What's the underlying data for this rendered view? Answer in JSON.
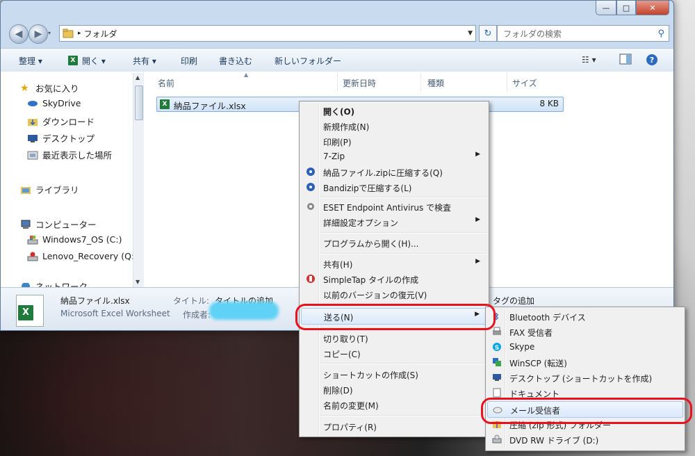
{
  "window": {
    "controls": {
      "minimize": "—",
      "maximize": "□",
      "close": "✕"
    }
  },
  "address": {
    "path": "フォルダ",
    "search_placeholder": "フォルダの検索"
  },
  "toolbar": {
    "organize": "整理 ▾",
    "open": "開く ▾",
    "share": "共有 ▾",
    "print": "印刷",
    "burn": "書き込む",
    "new_folder": "新しいフォルダー"
  },
  "nav": {
    "favorites": "お気に入り",
    "skydrive": "SkyDrive",
    "downloads": "ダウンロード",
    "desktop": "デスクトップ",
    "recent": "最近表示した場所",
    "libraries": "ライブラリ",
    "computer": "コンピューター",
    "drive_c": "Windows7_OS (C:)",
    "drive_q": "Lenovo_Recovery (Q:",
    "network": "ネットワーク"
  },
  "columns": {
    "name": "名前",
    "modified": "更新日時",
    "type": "種類",
    "size": "サイズ"
  },
  "file": {
    "name": "納品ファイル.xlsx",
    "size": "8 KB"
  },
  "details": {
    "name": "納品ファイル.xlsx",
    "type": "Microsoft Excel Worksheet",
    "title_label": "タイトル:",
    "title_value": "タイトルの追加",
    "author_label": "作成者:",
    "tags_value": "タグの追加"
  },
  "context_menu": {
    "open": "開く(O)",
    "new": "新規作成(N)",
    "print": "印刷(P)",
    "sevenzip": "7-Zip",
    "zip_compress": "納品ファイル.zipに圧縮する(Q)",
    "bandizip": "Bandizipで圧縮する(L)",
    "eset": "ESET Endpoint Antivirus で検査",
    "advanced": "詳細設定オプション",
    "open_with": "プログラムから開く(H)...",
    "share": "共有(H)",
    "simpletap": "SimpleTap タイルの作成",
    "restore": "以前のバージョンの復元(V)",
    "sendto": "送る(N)",
    "cut": "切り取り(T)",
    "copy": "コピー(C)",
    "shortcut": "ショートカットの作成(S)",
    "delete": "削除(D)",
    "rename": "名前の変更(M)",
    "properties": "プロパティ(R)"
  },
  "sendto_menu": {
    "bluetooth": "Bluetooth デバイス",
    "fax": "FAX 受信者",
    "skype": "Skype",
    "winscp": "WinSCP (転送)",
    "desktop": "デスクトップ (ショートカットを作成)",
    "documents": "ドキュメント",
    "mail": "メール受信者",
    "zip": "圧縮 (zip 形式) フォルダー",
    "dvd": "DVD RW ドライブ (D:)"
  },
  "highlight_color": "#e8121f"
}
